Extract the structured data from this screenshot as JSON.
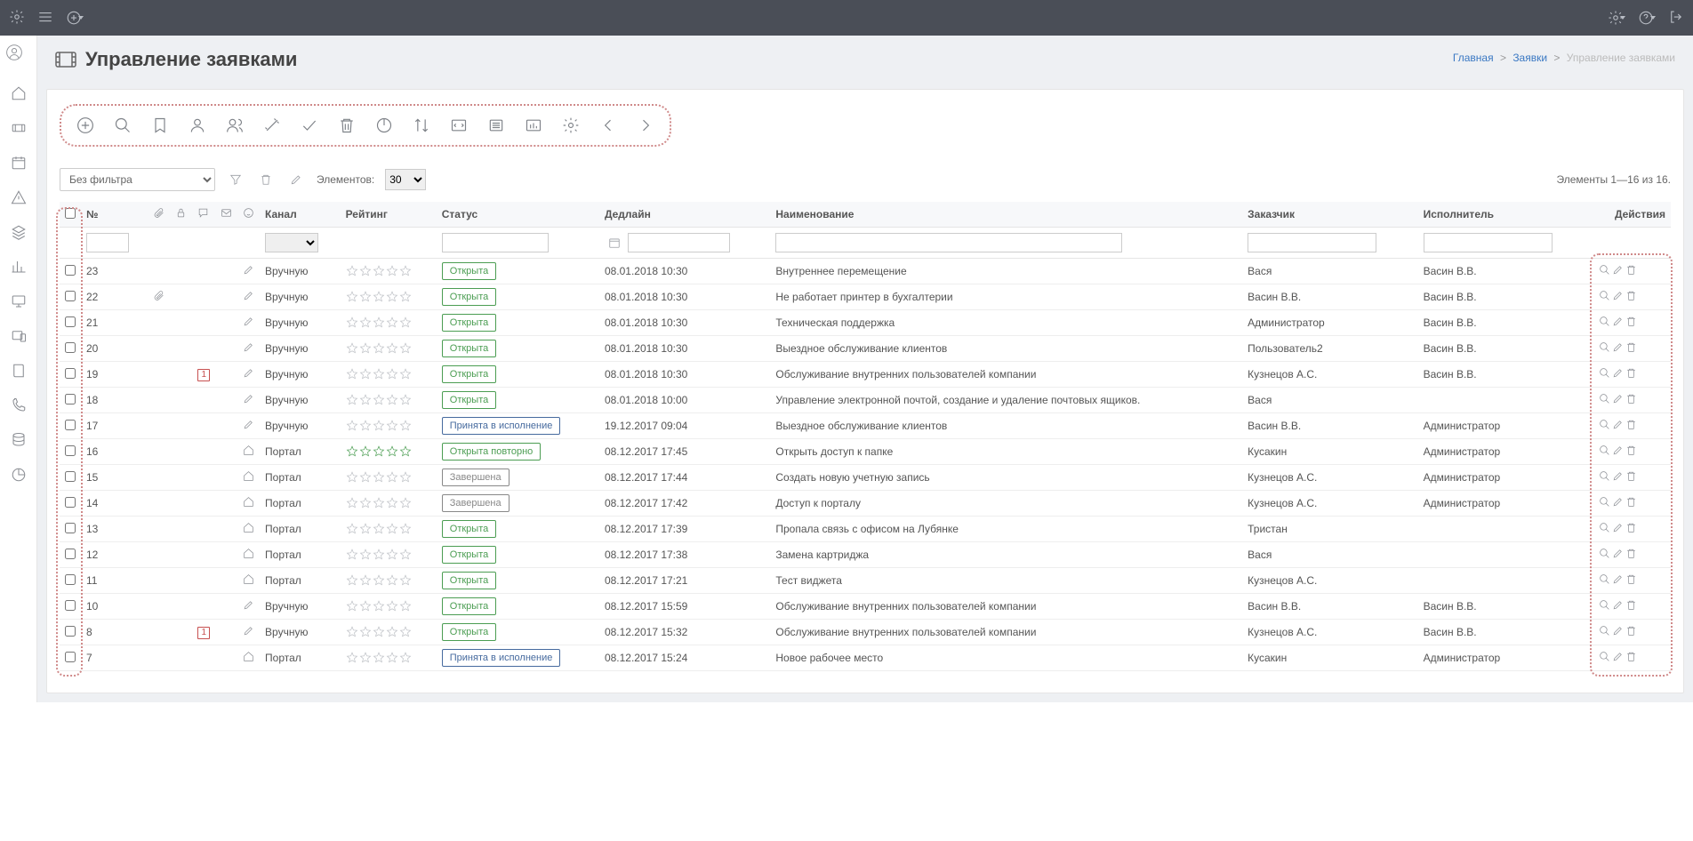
{
  "page": {
    "title": "Управление заявками"
  },
  "breadcrumb": {
    "home": "Главная",
    "parent": "Заявки",
    "current": "Управление заявками",
    "sep": ">"
  },
  "filter": {
    "noFilter": "Без фильтра",
    "elementsLabel": "Элементов:",
    "pageSize": "30",
    "summary": "Элементы 1—16 из 16."
  },
  "columns": {
    "num": "№",
    "channel": "Канал",
    "rating": "Рейтинг",
    "status": "Статус",
    "deadline": "Дедлайн",
    "name": "Наименование",
    "customer": "Заказчик",
    "executor": "Исполнитель",
    "actions": "Действия"
  },
  "statusLabels": {
    "open": "Открыта",
    "accepted": "Принята в исполнение",
    "reopen": "Открыта повторно",
    "done": "Завершена"
  },
  "rows": [
    {
      "num": "23",
      "attach": false,
      "note": "",
      "chanIcon": "pencil",
      "channel": "Вручную",
      "ratingType": "empty",
      "status": "open",
      "deadline": "08.01.2018 10:30",
      "name": "Внутреннее перемещение",
      "customer": "Вася",
      "executor": "Васин В.В."
    },
    {
      "num": "22",
      "attach": true,
      "note": "",
      "chanIcon": "pencil",
      "channel": "Вручную",
      "ratingType": "empty",
      "status": "open",
      "deadline": "08.01.2018 10:30",
      "name": "Не работает принтер в бухгалтерии",
      "customer": "Васин В.В.",
      "executor": "Васин В.В."
    },
    {
      "num": "21",
      "attach": false,
      "note": "",
      "chanIcon": "pencil",
      "channel": "Вручную",
      "ratingType": "empty",
      "status": "open",
      "deadline": "08.01.2018 10:30",
      "name": "Техническая поддержка",
      "customer": "Администратор",
      "executor": "Васин В.В."
    },
    {
      "num": "20",
      "attach": false,
      "note": "",
      "chanIcon": "pencil",
      "channel": "Вручную",
      "ratingType": "empty",
      "status": "open",
      "deadline": "08.01.2018 10:30",
      "name": "Выездное обслуживание клиентов",
      "customer": "Пользователь2",
      "executor": "Васин В.В."
    },
    {
      "num": "19",
      "attach": false,
      "note": "1",
      "chanIcon": "pencil",
      "channel": "Вручную",
      "ratingType": "empty",
      "status": "open",
      "deadline": "08.01.2018 10:30",
      "name": "Обслуживание внутренних пользователей компании",
      "customer": "Кузнецов А.С.",
      "executor": "Васин В.В."
    },
    {
      "num": "18",
      "attach": false,
      "note": "",
      "chanIcon": "pencil",
      "channel": "Вручную",
      "ratingType": "empty",
      "status": "open",
      "deadline": "08.01.2018 10:00",
      "name": "Управление электронной почтой, создание и удаление почтовых ящиков.",
      "customer": "Вася",
      "executor": ""
    },
    {
      "num": "17",
      "attach": false,
      "note": "",
      "chanIcon": "pencil",
      "channel": "Вручную",
      "ratingType": "empty",
      "status": "accepted",
      "deadline": "19.12.2017 09:04",
      "name": "Выездное обслуживание клиентов",
      "customer": "Васин В.В.",
      "executor": "Администратор"
    },
    {
      "num": "16",
      "attach": false,
      "note": "",
      "chanIcon": "home",
      "channel": "Портал",
      "ratingType": "green",
      "status": "reopen",
      "deadline": "08.12.2017 17:45",
      "name": "Открыть доступ к папке",
      "customer": "Кусакин",
      "executor": "Администратор"
    },
    {
      "num": "15",
      "attach": false,
      "note": "",
      "chanIcon": "home",
      "channel": "Портал",
      "ratingType": "empty",
      "status": "done",
      "deadline": "08.12.2017 17:44",
      "name": "Создать новую учетную запись",
      "customer": "Кузнецов А.С.",
      "executor": "Администратор"
    },
    {
      "num": "14",
      "attach": false,
      "note": "",
      "chanIcon": "home",
      "channel": "Портал",
      "ratingType": "empty",
      "status": "done",
      "deadline": "08.12.2017 17:42",
      "name": "Доступ к порталу",
      "customer": "Кузнецов А.С.",
      "executor": "Администратор"
    },
    {
      "num": "13",
      "attach": false,
      "note": "",
      "chanIcon": "home",
      "channel": "Портал",
      "ratingType": "empty",
      "status": "open",
      "deadline": "08.12.2017 17:39",
      "name": "Пропала связь с офисом на Лубянке",
      "customer": "Тристан",
      "executor": ""
    },
    {
      "num": "12",
      "attach": false,
      "note": "",
      "chanIcon": "home",
      "channel": "Портал",
      "ratingType": "empty",
      "status": "open",
      "deadline": "08.12.2017 17:38",
      "name": "Замена картриджа",
      "customer": "Вася",
      "executor": ""
    },
    {
      "num": "11",
      "attach": false,
      "note": "",
      "chanIcon": "home",
      "channel": "Портал",
      "ratingType": "empty",
      "status": "open",
      "deadline": "08.12.2017 17:21",
      "name": "Тест виджета",
      "customer": "Кузнецов А.С.",
      "executor": ""
    },
    {
      "num": "10",
      "attach": false,
      "note": "",
      "chanIcon": "pencil",
      "channel": "Вручную",
      "ratingType": "empty",
      "status": "open",
      "deadline": "08.12.2017 15:59",
      "name": "Обслуживание внутренних пользователей компании",
      "customer": "Васин В.В.",
      "executor": "Васин В.В."
    },
    {
      "num": "8",
      "attach": false,
      "note": "1",
      "chanIcon": "pencil",
      "channel": "Вручную",
      "ratingType": "empty",
      "status": "open",
      "deadline": "08.12.2017 15:32",
      "name": "Обслуживание внутренних пользователей компании",
      "customer": "Кузнецов А.С.",
      "executor": "Васин В.В."
    },
    {
      "num": "7",
      "attach": false,
      "note": "",
      "chanIcon": "home",
      "channel": "Портал",
      "ratingType": "empty",
      "status": "accepted",
      "deadline": "08.12.2017 15:24",
      "name": "Новое рабочее место",
      "customer": "Кусакин",
      "executor": "Администратор"
    }
  ]
}
